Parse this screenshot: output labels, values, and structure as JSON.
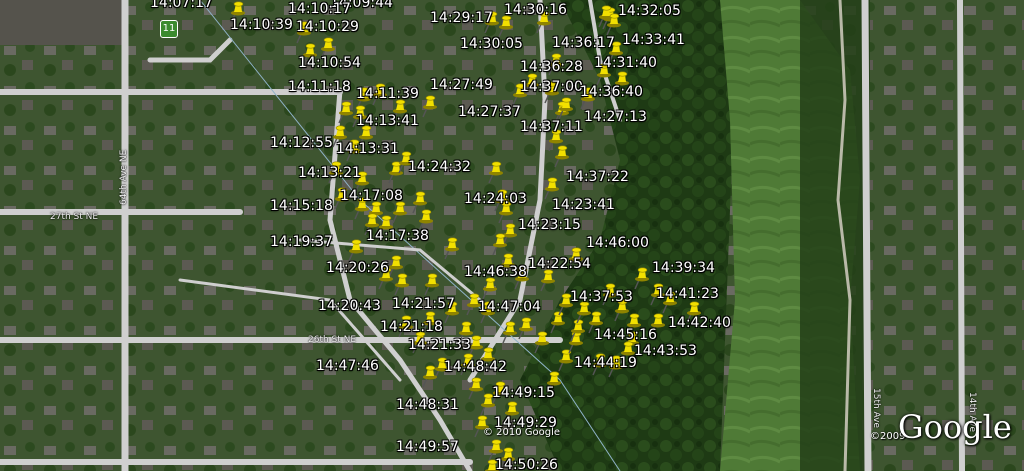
{
  "map": {
    "streets": {
      "ave_64th": "64th Ave NE",
      "st_27th": "27th St NE",
      "st_26th": "26th St NE",
      "ave_15th": "15th Ave",
      "ave_14th": "14th Ave"
    },
    "shield": "11",
    "logo": "Google",
    "copyright_imagery": "© 2010 Google",
    "copyright_data": "©2009"
  },
  "track_timestamps": [
    "14:07:17",
    "14:09:44",
    "14:10:17",
    "14:10:39",
    "14:10:29",
    "14:10:54",
    "14:11:18",
    "14:11:39",
    "14:13:41",
    "14:12:55",
    "14:13:31",
    "14:13:21",
    "14:17:08",
    "14:15:18",
    "14:17:38",
    "14:19:37",
    "14:20:26",
    "14:20:43",
    "14:21:57",
    "14:21:18",
    "14:21:33",
    "14:47:46",
    "14:48:42",
    "14:48:31",
    "14:49:15",
    "14:49:29",
    "14:49:57",
    "14:50:26",
    "14:29:17",
    "14:30:16",
    "14:32:05",
    "14:30:05",
    "14:36:17",
    "14:33:41",
    "14:36:28",
    "14:31:40",
    "14:27:49",
    "14:37:00",
    "14:36:40",
    "14:27:37",
    "14:37:11",
    "14:27:13",
    "14:24:32",
    "14:37:22",
    "14:24:03",
    "14:23:41",
    "14:23:15",
    "14:46:00",
    "14:46:38",
    "14:22:54",
    "14:39:34",
    "14:47:04",
    "14:37:53",
    "14:41:23",
    "14:42:40",
    "14:45:16",
    "14:43:53",
    "14:44:19"
  ],
  "colors": {
    "pin": "#f2e000",
    "pin_shade": "#8f8400",
    "label": "#ffffff",
    "road": "#cfcfcf"
  }
}
